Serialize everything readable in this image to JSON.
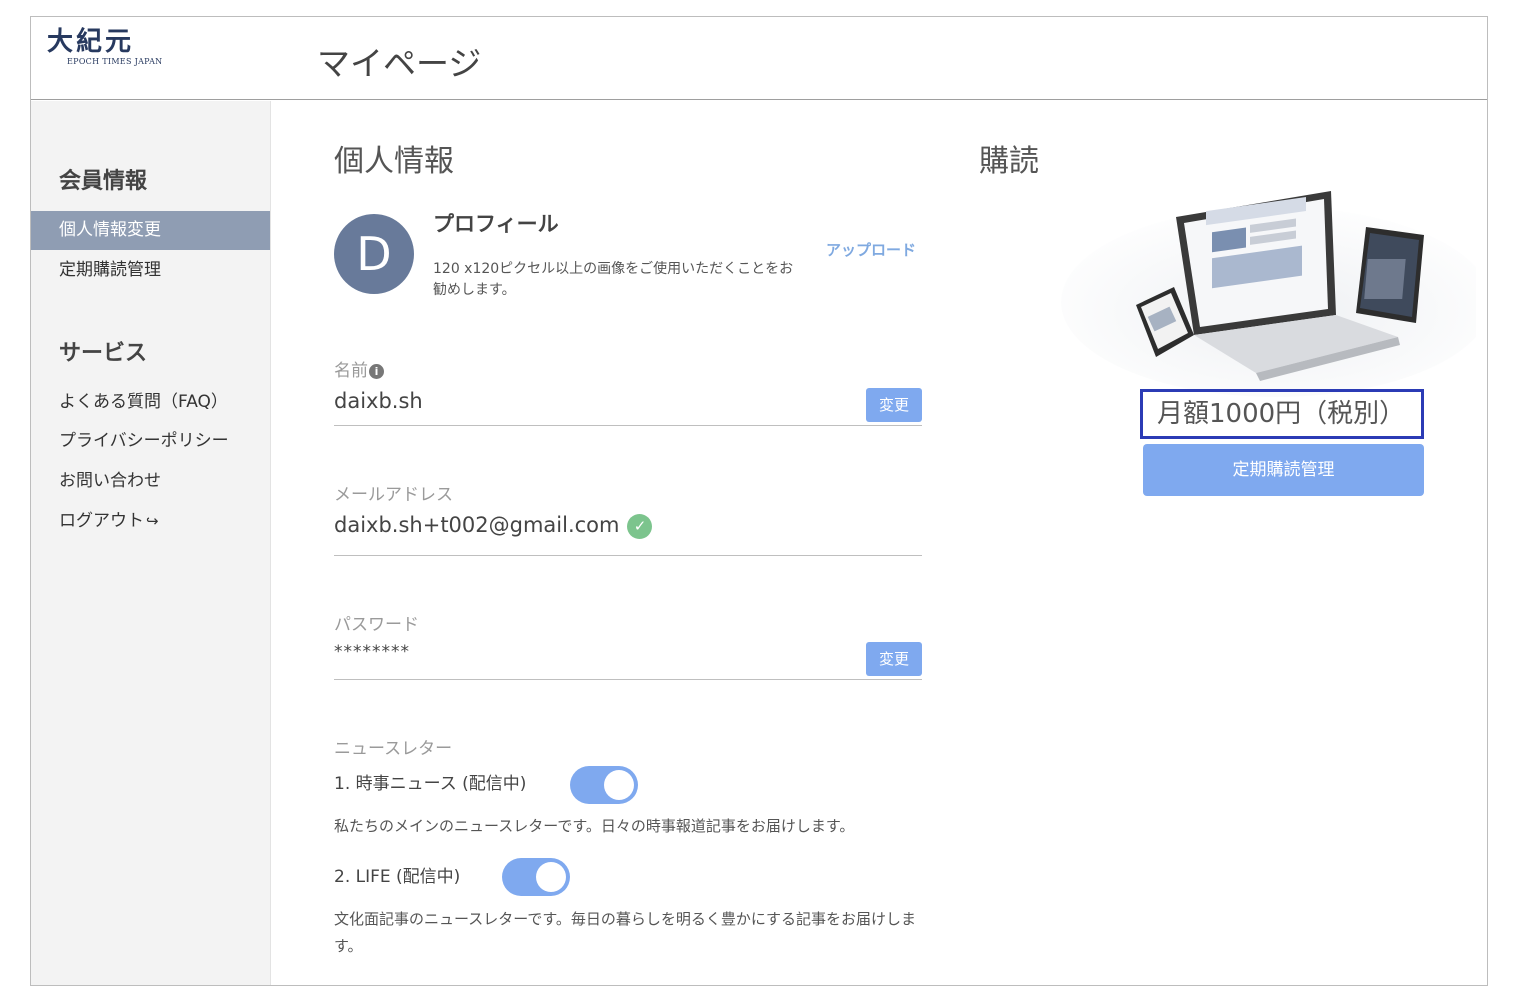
{
  "header": {
    "logo_text": "大紀元",
    "logo_subtext": "EPOCH TIMES JAPAN",
    "page_title": "マイページ"
  },
  "sidebar": {
    "member_section": "会員情報",
    "member_items": [
      "個人情報変更",
      "定期購読管理"
    ],
    "service_section": "サービス",
    "service_items": [
      "よくある質問（FAQ）",
      "プライバシーポリシー",
      "お問い合わせ",
      "ログアウト"
    ],
    "logout_icon": "sign-out-icon"
  },
  "personal": {
    "heading": "個人情報",
    "avatar_letter": "D",
    "profile_title": "プロフィール",
    "profile_desc": "120 x120ピクセル以上の画像をご使用いただくことをお勧めします。",
    "upload_label": "アップロード",
    "name_label": "名前",
    "name_value": "daixb.sh",
    "change_label": "変更",
    "email_label": "メールアドレス",
    "email_value": "daixb.sh+t002@gmail.com",
    "password_label": "パスワード",
    "password_value": "********"
  },
  "newsletter": {
    "label": "ニュースレター",
    "items": [
      {
        "title": "1. 時事ニュース (配信中)",
        "desc": "私たちのメインのニュースレターです。日々の時事報道記事をお届けします。",
        "enabled": true
      },
      {
        "title": "2. LIFE (配信中)",
        "desc": "文化面記事のニュースレターです。毎日の暮らしを明るく豊かにする記事をお届けします。",
        "enabled": true
      }
    ]
  },
  "subscription": {
    "heading": "購読",
    "price": "月額1000円（税別）",
    "manage_button": "定期購読管理"
  },
  "colors": {
    "accent": "#7fa9ef",
    "sidebar_active": "#8f9db3",
    "avatar": "#687a9a",
    "highlight_border": "#2b3bb5",
    "verified": "#7cc48d"
  }
}
